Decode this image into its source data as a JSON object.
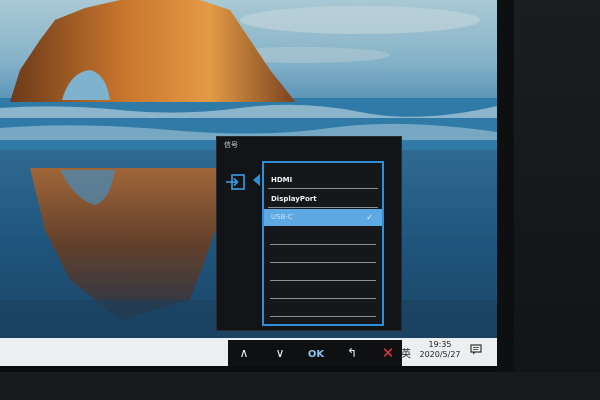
{
  "taskbar": {
    "ime_label": "英",
    "time": "19:35",
    "date": "2020/5/27"
  },
  "osd": {
    "title": "信号",
    "category_icon": "input-source-icon",
    "accent_color": "#2f8fd6",
    "selected_color": "#5ea9e3",
    "items": [
      {
        "label": "HDMI"
      },
      {
        "label": "DisplayPort"
      },
      {
        "label": "USB-C",
        "selected": true
      }
    ],
    "buttons": [
      {
        "icon": "chevron-up-icon",
        "glyph": "∧"
      },
      {
        "icon": "chevron-down-icon",
        "glyph": "∨"
      },
      {
        "label": "OK"
      },
      {
        "icon": "back-icon",
        "glyph": "↰"
      },
      {
        "icon": "close-icon",
        "glyph": "✕"
      }
    ]
  }
}
